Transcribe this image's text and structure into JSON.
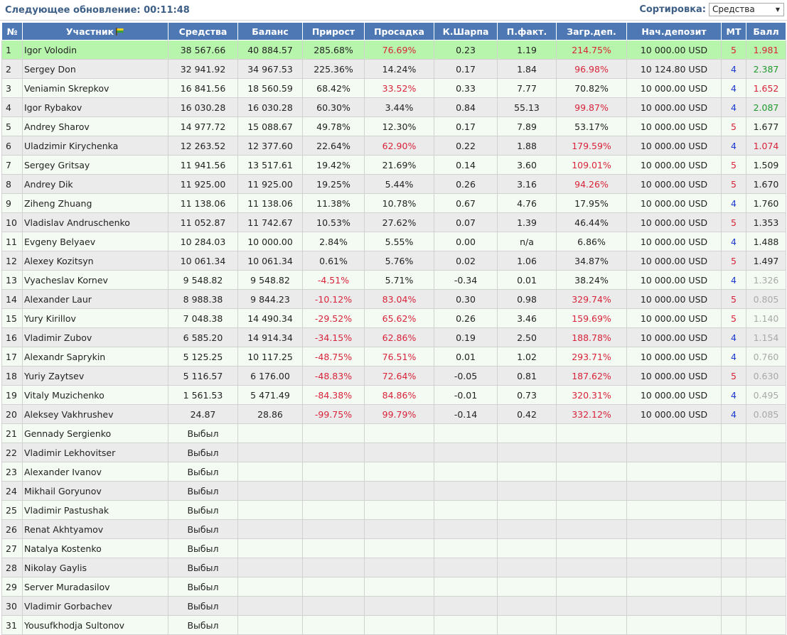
{
  "header": {
    "update_label": "Следующее обновление: 00:11:48",
    "sort_label": "Сортировка:",
    "sort_value": "Средства"
  },
  "columns": [
    "№",
    "Участник",
    "Средства",
    "Баланс",
    "Прирост",
    "Просадка",
    "К.Шарпа",
    "П.факт.",
    "Загр.деп.",
    "Нач.депозит",
    "МТ",
    "Балл"
  ],
  "colors": {
    "header_bg": "#4e78b4",
    "row_odd": "#f4fbf2",
    "row_even": "#ebebeb",
    "row_lead": "#b7f5ac",
    "red": "#d9233a",
    "green": "#1f9a2c",
    "blue": "#1a3ad1",
    "gray": "#a9a9a9"
  },
  "rows": [
    {
      "n": "1",
      "name": "Igor Volodin",
      "funds": "38 567.66",
      "balance": "40 884.57",
      "growth": "285.68%",
      "growth_c": "",
      "dd": "76.69%",
      "dd_c": "red",
      "sharpe": "0.23",
      "pf": "1.19",
      "load": "214.75%",
      "load_c": "red",
      "deposit": "10 000.00 USD",
      "mt": "5",
      "mt_c": "red",
      "score": "1.981",
      "score_c": "red"
    },
    {
      "n": "2",
      "name": "Sergey Don",
      "funds": "32 941.92",
      "balance": "34 967.53",
      "growth": "225.36%",
      "growth_c": "",
      "dd": "14.24%",
      "dd_c": "",
      "sharpe": "0.17",
      "pf": "1.84",
      "load": "96.98%",
      "load_c": "red",
      "deposit": "10 124.80 USD",
      "mt": "4",
      "mt_c": "blue",
      "score": "2.387",
      "score_c": "green"
    },
    {
      "n": "3",
      "name": "Veniamin Skrepkov",
      "funds": "16 841.56",
      "balance": "18 560.59",
      "growth": "68.42%",
      "growth_c": "",
      "dd": "33.52%",
      "dd_c": "red",
      "sharpe": "0.33",
      "pf": "7.77",
      "load": "70.82%",
      "load_c": "",
      "deposit": "10 000.00 USD",
      "mt": "4",
      "mt_c": "blue",
      "score": "1.652",
      "score_c": "red"
    },
    {
      "n": "4",
      "name": "Igor Rybakov",
      "funds": "16 030.28",
      "balance": "16 030.28",
      "growth": "60.30%",
      "growth_c": "",
      "dd": "3.44%",
      "dd_c": "",
      "sharpe": "0.84",
      "pf": "55.13",
      "load": "99.87%",
      "load_c": "red",
      "deposit": "10 000.00 USD",
      "mt": "4",
      "mt_c": "blue",
      "score": "2.087",
      "score_c": "green"
    },
    {
      "n": "5",
      "name": "Andrey Sharov",
      "funds": "14 977.72",
      "balance": "15 088.67",
      "growth": "49.78%",
      "growth_c": "",
      "dd": "12.30%",
      "dd_c": "",
      "sharpe": "0.17",
      "pf": "7.89",
      "load": "53.17%",
      "load_c": "",
      "deposit": "10 000.00 USD",
      "mt": "5",
      "mt_c": "red",
      "score": "1.677",
      "score_c": ""
    },
    {
      "n": "6",
      "name": "Uladzimir Kirychenka",
      "funds": "12 263.52",
      "balance": "12 377.60",
      "growth": "22.64%",
      "growth_c": "",
      "dd": "62.90%",
      "dd_c": "red",
      "sharpe": "0.22",
      "pf": "1.88",
      "load": "179.59%",
      "load_c": "red",
      "deposit": "10 000.00 USD",
      "mt": "4",
      "mt_c": "blue",
      "score": "1.074",
      "score_c": "red"
    },
    {
      "n": "7",
      "name": "Sergey Gritsay",
      "funds": "11 941.56",
      "balance": "13 517.61",
      "growth": "19.42%",
      "growth_c": "",
      "dd": "21.69%",
      "dd_c": "",
      "sharpe": "0.14",
      "pf": "3.60",
      "load": "109.01%",
      "load_c": "red",
      "deposit": "10 000.00 USD",
      "mt": "5",
      "mt_c": "red",
      "score": "1.509",
      "score_c": ""
    },
    {
      "n": "8",
      "name": "Andrey Dik",
      "funds": "11 925.00",
      "balance": "11 925.00",
      "growth": "19.25%",
      "growth_c": "",
      "dd": "5.44%",
      "dd_c": "",
      "sharpe": "0.26",
      "pf": "3.16",
      "load": "94.26%",
      "load_c": "red",
      "deposit": "10 000.00 USD",
      "mt": "5",
      "mt_c": "red",
      "score": "1.670",
      "score_c": ""
    },
    {
      "n": "9",
      "name": "Ziheng Zhuang",
      "funds": "11 138.06",
      "balance": "11 138.06",
      "growth": "11.38%",
      "growth_c": "",
      "dd": "10.78%",
      "dd_c": "",
      "sharpe": "0.67",
      "pf": "4.76",
      "load": "17.95%",
      "load_c": "",
      "deposit": "10 000.00 USD",
      "mt": "4",
      "mt_c": "blue",
      "score": "1.760",
      "score_c": ""
    },
    {
      "n": "10",
      "name": "Vladislav Andruschenko",
      "funds": "11 052.87",
      "balance": "11 742.67",
      "growth": "10.53%",
      "growth_c": "",
      "dd": "27.62%",
      "dd_c": "",
      "sharpe": "0.07",
      "pf": "1.39",
      "load": "46.44%",
      "load_c": "",
      "deposit": "10 000.00 USD",
      "mt": "5",
      "mt_c": "red",
      "score": "1.353",
      "score_c": ""
    },
    {
      "n": "11",
      "name": "Evgeny Belyaev",
      "funds": "10 284.03",
      "balance": "10 000.00",
      "growth": "2.84%",
      "growth_c": "",
      "dd": "5.55%",
      "dd_c": "",
      "sharpe": "0.00",
      "pf": "n/a",
      "load": "6.86%",
      "load_c": "",
      "deposit": "10 000.00 USD",
      "mt": "4",
      "mt_c": "blue",
      "score": "1.488",
      "score_c": ""
    },
    {
      "n": "12",
      "name": "Alexey Kozitsyn",
      "funds": "10 061.34",
      "balance": "10 061.34",
      "growth": "0.61%",
      "growth_c": "",
      "dd": "5.76%",
      "dd_c": "",
      "sharpe": "0.02",
      "pf": "1.06",
      "load": "34.87%",
      "load_c": "",
      "deposit": "10 000.00 USD",
      "mt": "5",
      "mt_c": "red",
      "score": "1.497",
      "score_c": ""
    },
    {
      "n": "13",
      "name": "Vyacheslav Kornev",
      "funds": "9 548.82",
      "balance": "9 548.82",
      "growth": "-4.51%",
      "growth_c": "red",
      "dd": "5.71%",
      "dd_c": "",
      "sharpe": "-0.34",
      "pf": "0.01",
      "load": "38.24%",
      "load_c": "",
      "deposit": "10 000.00 USD",
      "mt": "4",
      "mt_c": "blue",
      "score": "1.326",
      "score_c": "gray"
    },
    {
      "n": "14",
      "name": "Alexander Laur",
      "funds": "8 988.38",
      "balance": "9 844.23",
      "growth": "-10.12%",
      "growth_c": "red",
      "dd": "83.04%",
      "dd_c": "red",
      "sharpe": "0.30",
      "pf": "0.98",
      "load": "329.74%",
      "load_c": "red",
      "deposit": "10 000.00 USD",
      "mt": "5",
      "mt_c": "red",
      "score": "0.805",
      "score_c": "gray"
    },
    {
      "n": "15",
      "name": "Yury Kirillov",
      "funds": "7 048.38",
      "balance": "14 490.34",
      "growth": "-29.52%",
      "growth_c": "red",
      "dd": "65.62%",
      "dd_c": "red",
      "sharpe": "0.26",
      "pf": "3.46",
      "load": "159.69%",
      "load_c": "red",
      "deposit": "10 000.00 USD",
      "mt": "5",
      "mt_c": "red",
      "score": "1.140",
      "score_c": "gray"
    },
    {
      "n": "16",
      "name": "Vladimir Zubov",
      "funds": "6 585.20",
      "balance": "14 914.34",
      "growth": "-34.15%",
      "growth_c": "red",
      "dd": "62.86%",
      "dd_c": "red",
      "sharpe": "0.19",
      "pf": "2.50",
      "load": "188.78%",
      "load_c": "red",
      "deposit": "10 000.00 USD",
      "mt": "4",
      "mt_c": "blue",
      "score": "1.154",
      "score_c": "gray"
    },
    {
      "n": "17",
      "name": "Alexandr Saprykin",
      "funds": "5 125.25",
      "balance": "10 117.25",
      "growth": "-48.75%",
      "growth_c": "red",
      "dd": "76.51%",
      "dd_c": "red",
      "sharpe": "0.01",
      "pf": "1.02",
      "load": "293.71%",
      "load_c": "red",
      "deposit": "10 000.00 USD",
      "mt": "4",
      "mt_c": "blue",
      "score": "0.760",
      "score_c": "gray"
    },
    {
      "n": "18",
      "name": "Yuriy Zaytsev",
      "funds": "5 116.57",
      "balance": "6 176.00",
      "growth": "-48.83%",
      "growth_c": "red",
      "dd": "72.64%",
      "dd_c": "red",
      "sharpe": "-0.05",
      "pf": "0.81",
      "load": "187.62%",
      "load_c": "red",
      "deposit": "10 000.00 USD",
      "mt": "5",
      "mt_c": "red",
      "score": "0.630",
      "score_c": "gray"
    },
    {
      "n": "19",
      "name": "Vitaly Muzichenko",
      "funds": "1 561.53",
      "balance": "5 471.49",
      "growth": "-84.38%",
      "growth_c": "red",
      "dd": "84.86%",
      "dd_c": "red",
      "sharpe": "-0.01",
      "pf": "0.73",
      "load": "320.31%",
      "load_c": "red",
      "deposit": "10 000.00 USD",
      "mt": "4",
      "mt_c": "blue",
      "score": "0.495",
      "score_c": "gray"
    },
    {
      "n": "20",
      "name": "Aleksey Vakhrushev",
      "funds": "24.87",
      "balance": "28.86",
      "growth": "-99.75%",
      "growth_c": "red",
      "dd": "99.79%",
      "dd_c": "red",
      "sharpe": "-0.14",
      "pf": "0.42",
      "load": "332.12%",
      "load_c": "red",
      "deposit": "10 000.00 USD",
      "mt": "4",
      "mt_c": "blue",
      "score": "0.085",
      "score_c": "gray"
    },
    {
      "n": "21",
      "name": "Gennady Sergienko",
      "funds": "Выбыл"
    },
    {
      "n": "22",
      "name": "Vladimir Lekhovitser",
      "funds": "Выбыл"
    },
    {
      "n": "23",
      "name": "Alexander Ivanov",
      "funds": "Выбыл"
    },
    {
      "n": "24",
      "name": "Mikhail Goryunov",
      "funds": "Выбыл"
    },
    {
      "n": "25",
      "name": "Vladimir Pastushak",
      "funds": "Выбыл"
    },
    {
      "n": "26",
      "name": "Renat Akhtyamov",
      "funds": "Выбыл"
    },
    {
      "n": "27",
      "name": "Natalya Kostenko",
      "funds": "Выбыл"
    },
    {
      "n": "28",
      "name": "Nikolay Gaylis",
      "funds": "Выбыл"
    },
    {
      "n": "29",
      "name": "Server Muradasilov",
      "funds": "Выбыл"
    },
    {
      "n": "30",
      "name": "Vladimir Gorbachev",
      "funds": "Выбыл"
    },
    {
      "n": "31",
      "name": "Yousufkhodja Sultonov",
      "funds": "Выбыл"
    }
  ]
}
